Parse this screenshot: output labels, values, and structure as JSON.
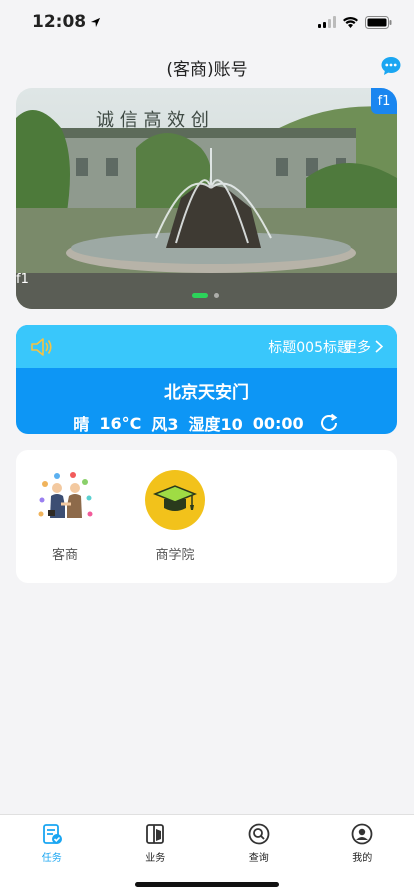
{
  "status_bar": {
    "time": "12:08"
  },
  "header": {
    "title": "(客商)账号"
  },
  "banner": {
    "tag": "f1",
    "caption": "f1",
    "sign_text": "诚 信 高 效 创"
  },
  "notice": {
    "text": "标题005标题",
    "more_label": "更多"
  },
  "weather": {
    "city": "北京天安门",
    "condition": "晴",
    "temperature": "16°C",
    "wind": "风3",
    "humidity": "湿度10",
    "time": "00:00"
  },
  "modules": [
    {
      "label": "客商",
      "icon": "handshake-icon"
    },
    {
      "label": "商学院",
      "icon": "graduation-cap-icon"
    }
  ],
  "tabs": [
    {
      "label": "任务",
      "icon": "task-icon",
      "active": true
    },
    {
      "label": "业务",
      "icon": "business-icon",
      "active": false
    },
    {
      "label": "查询",
      "icon": "search-icon",
      "active": false
    },
    {
      "label": "我的",
      "icon": "profile-icon",
      "active": false
    }
  ],
  "colors": {
    "accent": "#1aa6f2",
    "notice_bg": "#39c7fb",
    "weather_bg": "#0d96f5",
    "dot_active": "#2cd35a"
  }
}
